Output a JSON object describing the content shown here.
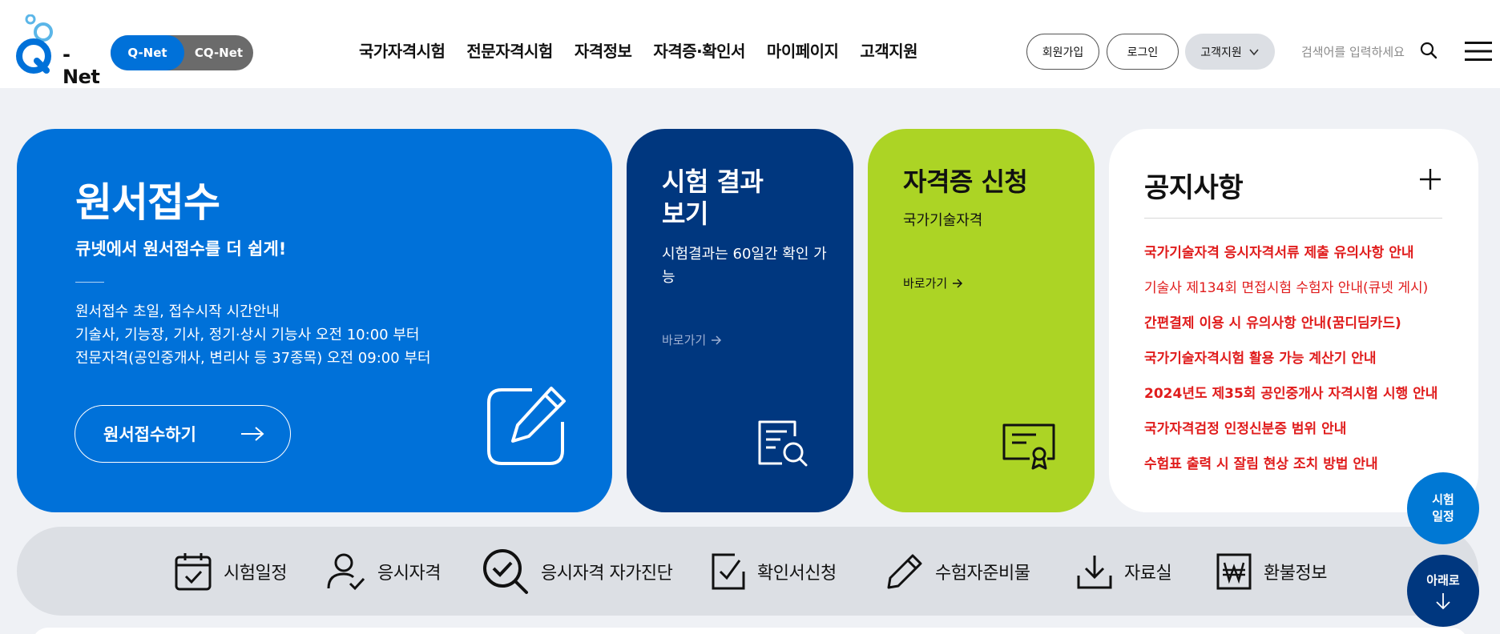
{
  "header": {
    "logo_text": "- Net",
    "net_switch": {
      "qnet": "Q-Net",
      "cqnet": "CQ-Net"
    },
    "gnb": [
      "국가자격시험",
      "전문자격시험",
      "자격정보",
      "자격증·확인서",
      "마이페이지",
      "고객지원"
    ],
    "util": {
      "join": "회원가입",
      "login": "로그인",
      "support": "고객지원"
    },
    "search_placeholder": "검색어를 입력하세요"
  },
  "apply_card": {
    "title": "원서접수",
    "subtitle": "큐넷에서 원서접수를 더 쉽게!",
    "info": [
      "원서접수 초일, 접수시작 시간안내",
      "기술사, 기능장, 기사, 정기·상시 기능사 오전 10:00 부터",
      "전문자격(공인중개사, 변리사 등 37종목) 오전 09:00 부터"
    ],
    "button": "원서접수하기"
  },
  "result_card": {
    "title_line1": "시험 결과",
    "title_line2": "보기",
    "subtitle": "시험결과는 60일간 확인 가능",
    "goto": "바로가기"
  },
  "cert_card": {
    "title": "자격증 신청",
    "subtitle": "국가기술자격",
    "goto": "바로가기"
  },
  "notice": {
    "title": "공지사항",
    "items": [
      "국가기술자격 응시자격서류 제출 유의사항 안내",
      "기술사 제134회 면접시험 수험자 안내(큐넷 게시)",
      "간편결제 이용 시 유의사항 안내(꿈디딤카드)",
      "국가기술자격시험 활용 가능 계산기 안내",
      "2024년도 제35회 공인중개사 자격시험 시행 안내",
      "국가자격검정 인정신분증 범위 안내",
      "수험표 출력 시 잘림 현상 조치 방법 안내"
    ]
  },
  "quick_menu": [
    "시험일정",
    "응시자격",
    "응시자격 자가진단",
    "확인서신청",
    "수험자준비물",
    "자료실",
    "환불정보"
  ],
  "floating": {
    "schedule_line1": "시험",
    "schedule_line2": "일정",
    "down": "아래로"
  },
  "colors": {
    "brand_blue": "#0071d9",
    "navy": "#00377f",
    "lime": "#acd425",
    "notice_red": "#e01c1c"
  }
}
